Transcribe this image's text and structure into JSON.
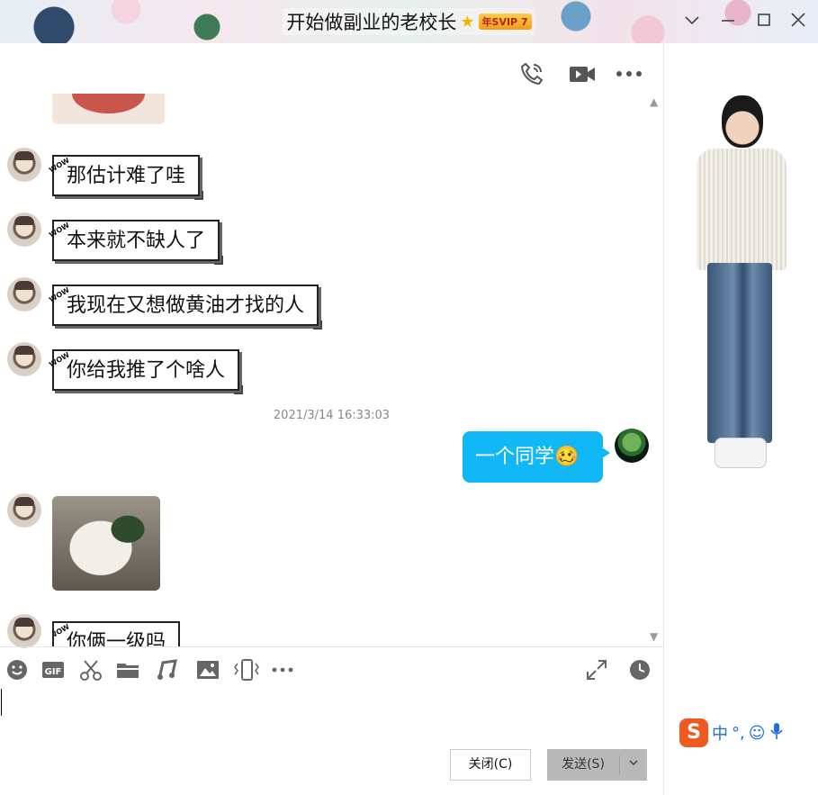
{
  "window": {
    "title": "开始做副业的老校长",
    "vip_badge": "年SVIP 7"
  },
  "messages": [
    {
      "text": "那估计难了哇"
    },
    {
      "text": "本来就不缺人了"
    },
    {
      "text": "我现在又想做黄油才找的人"
    },
    {
      "text": "你给我推了个啥人"
    },
    {
      "timestamp": "2021/3/14 16:33:03"
    },
    {
      "text": "一个同学",
      "emoji": "🥴"
    },
    {
      "text": "你俩一级吗"
    }
  ],
  "composer": {
    "close_label": "关闭(C)",
    "send_label": "发送(S)"
  },
  "ime": {
    "logo": "S",
    "mode": "中",
    "punct": "°,"
  },
  "colors": {
    "accent": "#12b7f5",
    "send_bg": "#b9b9b9"
  }
}
